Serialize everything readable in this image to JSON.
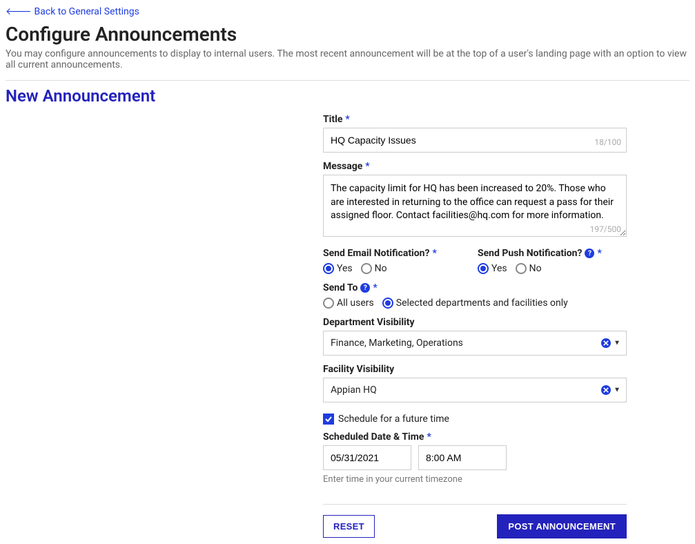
{
  "back_link": "Back to General Settings",
  "page_title": "Configure Announcements",
  "page_desc": "You may configure announcements to display to internal users. The most recent announcement will be at the top of a user's landing page with an option to view all current announcements.",
  "section_title": "New Announcement",
  "form": {
    "title": {
      "label": "Title",
      "value": "HQ Capacity Issues",
      "count": "18/100"
    },
    "message": {
      "label": "Message",
      "value": "The capacity limit for HQ has been increased to 20%. Those who are interested in returning to the office can request a pass for their assigned floor. Contact facilities@hq.com for more information.",
      "count": "197/500"
    },
    "email_notif": {
      "label": "Send Email Notification?",
      "yes": "Yes",
      "no": "No"
    },
    "push_notif": {
      "label": "Send Push Notification?",
      "yes": "Yes",
      "no": "No"
    },
    "send_to": {
      "label": "Send To",
      "all_users": "All users",
      "selected": "Selected departments and facilities only"
    },
    "dept_vis": {
      "label": "Department Visibility",
      "value": "Finance, Marketing, Operations"
    },
    "facility_vis": {
      "label": "Facility Visibility",
      "value": "Appian HQ"
    },
    "schedule_checkbox": "Schedule for a future time",
    "scheduled": {
      "label": "Scheduled Date & Time",
      "date": "05/31/2021",
      "time": "8:00 AM",
      "hint": "Enter time in your current timezone"
    },
    "buttons": {
      "reset": "RESET",
      "post": "POST ANNOUNCEMENT"
    }
  }
}
